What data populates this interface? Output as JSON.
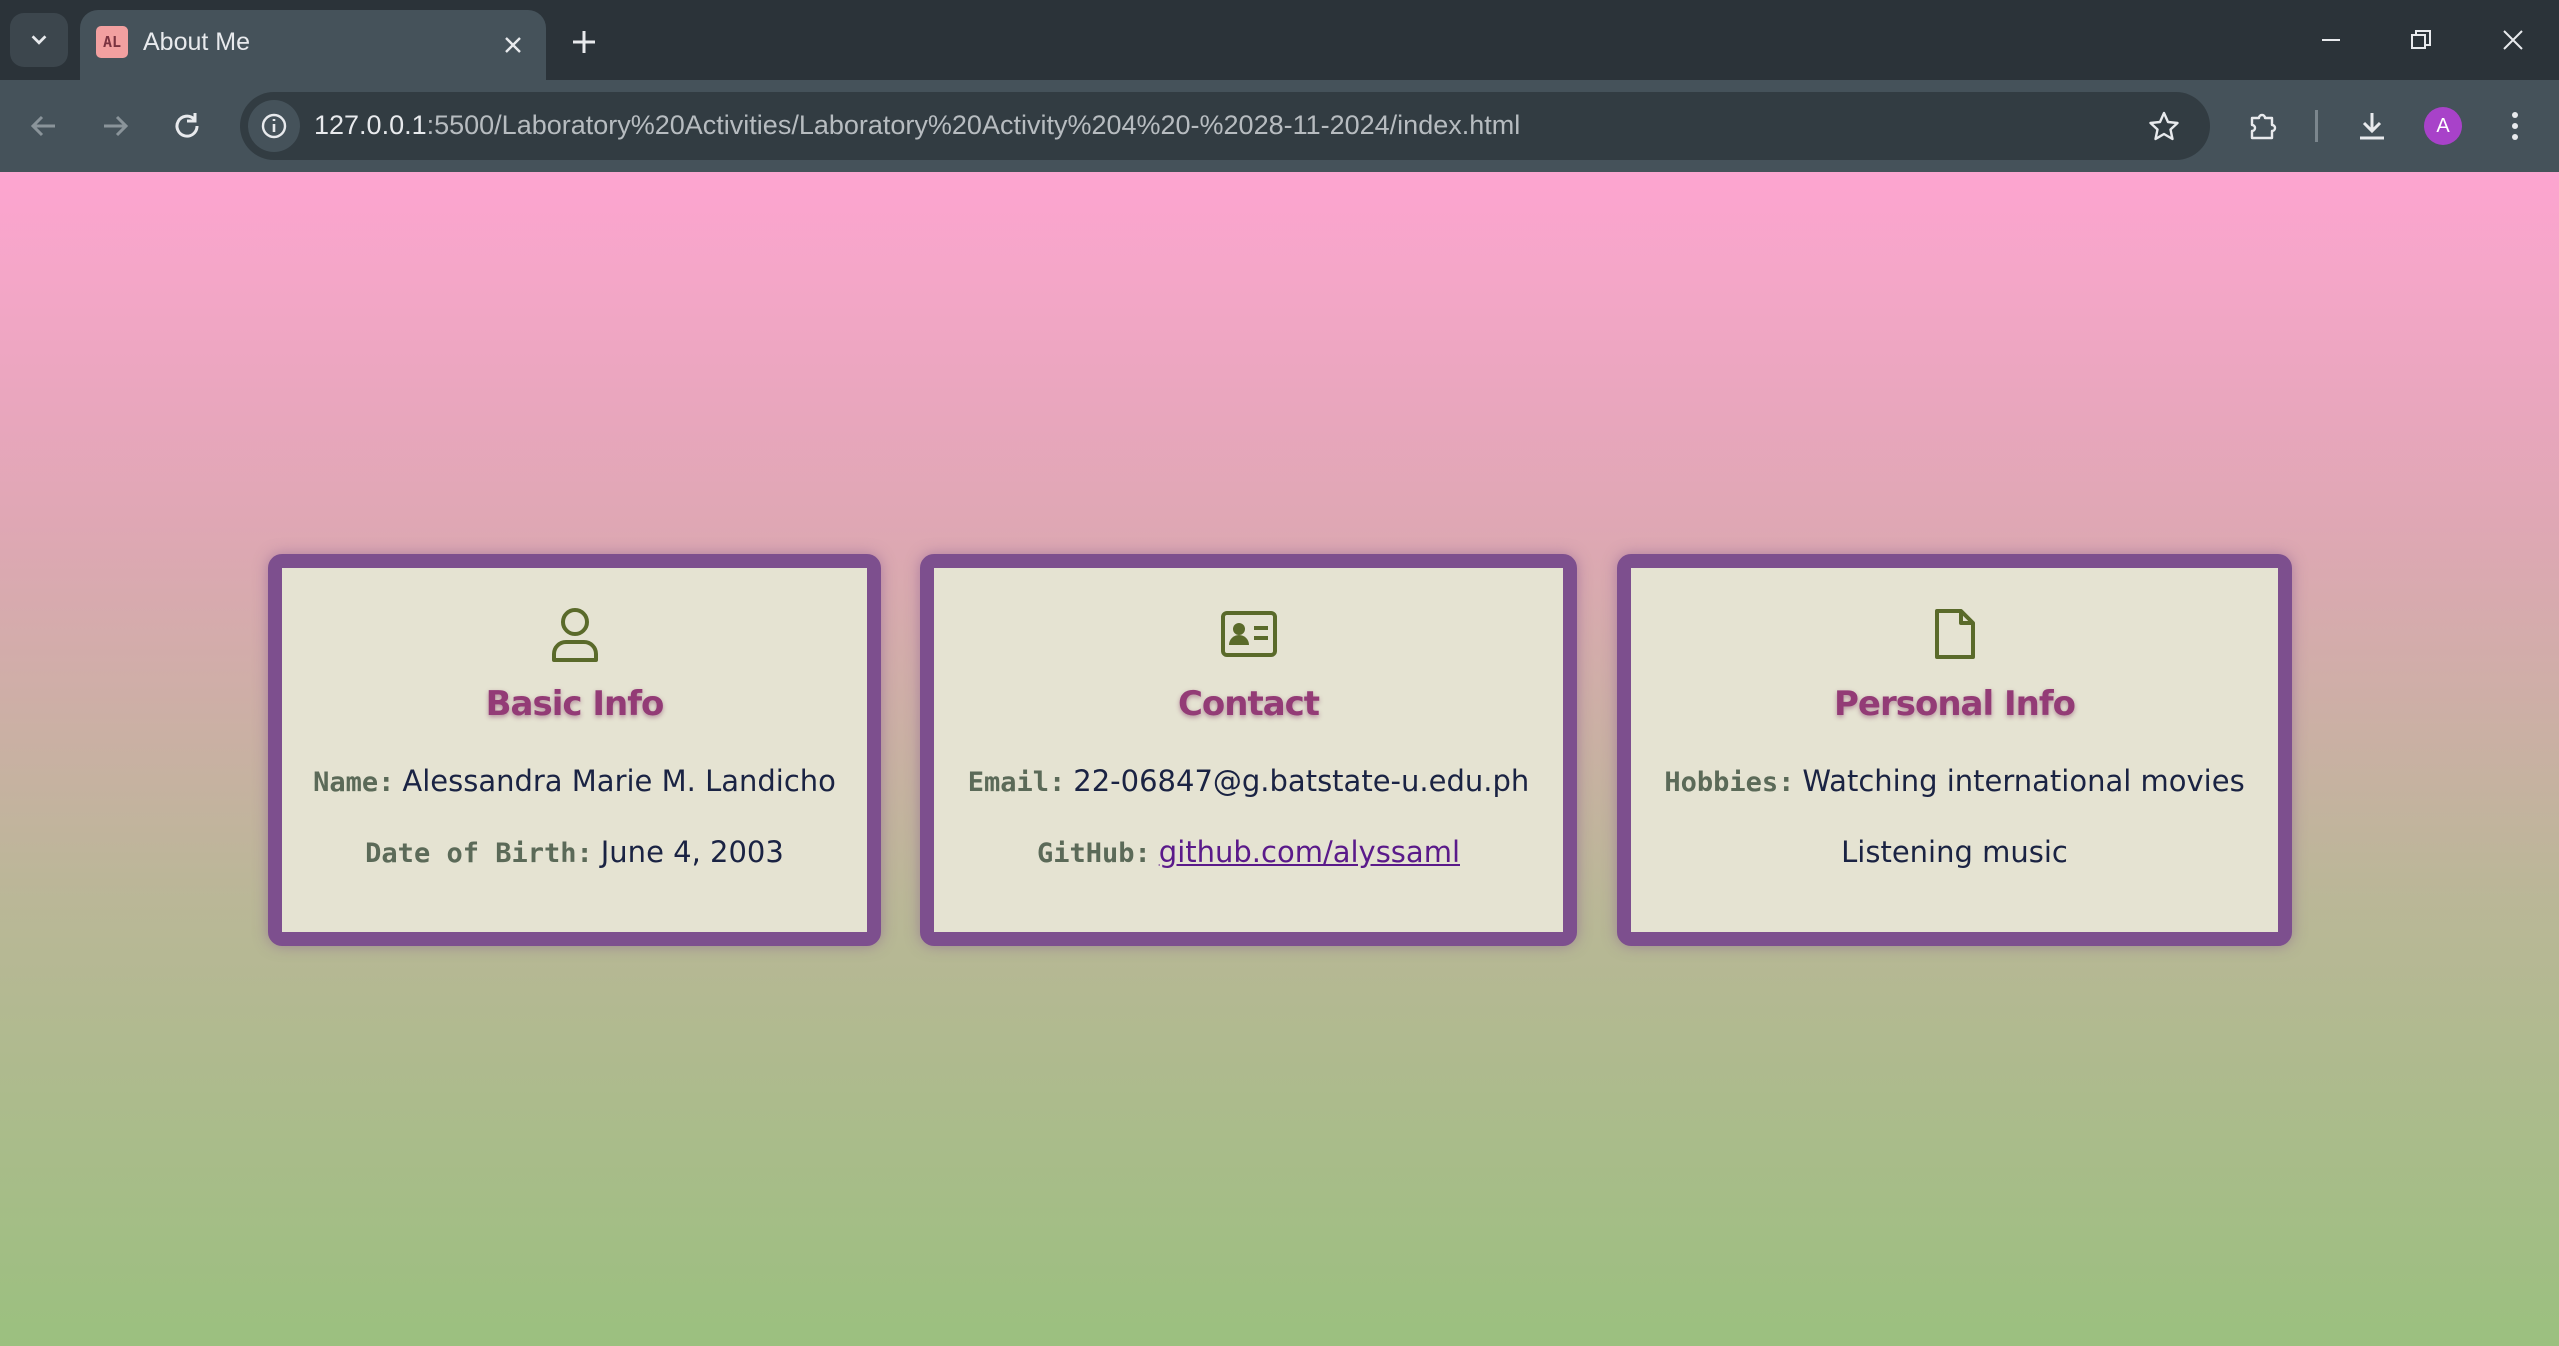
{
  "browser": {
    "tab_title": "About Me",
    "favicon_text": "AL",
    "url_host": "127.0.0.1",
    "url_rest": ":5500/Laboratory%20Activities/Laboratory%20Activity%204%20-%2028-11-2024/index.html",
    "profile_initial": "A"
  },
  "cards": {
    "basic": {
      "icon": "user-icon",
      "title": "Basic Info",
      "name_label": "Name:",
      "name_value": "Alessandra Marie M. Landicho",
      "dob_label": "Date of Birth:",
      "dob_value": "June 4, 2003"
    },
    "contact": {
      "icon": "id-card-icon",
      "title": "Contact",
      "email_label": "Email:",
      "email_value": "22-06847@g.batstate-u.edu.ph",
      "github_label": "GitHub:",
      "github_value": "github.com/alyssaml"
    },
    "personal": {
      "icon": "document-icon",
      "title": "Personal Info",
      "hobbies_label": "Hobbies:",
      "hobby_1": "Watching international movies",
      "hobby_2": "Listening music"
    }
  },
  "colors": {
    "card_border": "#7d4f8e",
    "card_bg": "#e5e3d2",
    "title": "#933b76",
    "gradient_top": "#fda5d0",
    "gradient_bottom": "#9bc07f"
  }
}
